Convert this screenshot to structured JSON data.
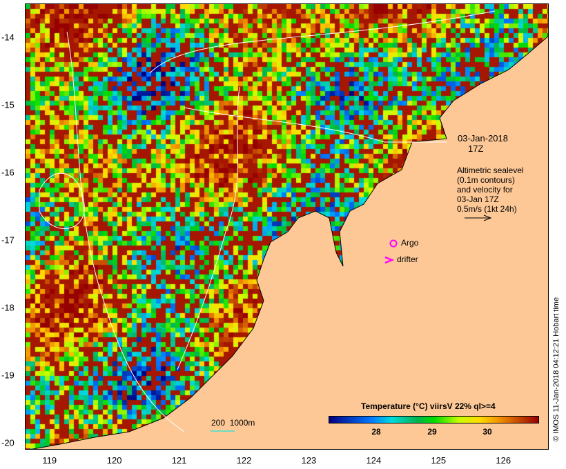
{
  "axes": {
    "x_ticks": [
      "119",
      "120",
      "121",
      "122",
      "123",
      "124",
      "125",
      "126"
    ],
    "x_values": [
      119,
      120,
      121,
      122,
      123,
      124,
      125,
      126
    ],
    "y_ticks": [
      "-14",
      "-15",
      "-16",
      "-17",
      "-18",
      "-19",
      "-20"
    ],
    "y_values": [
      -14,
      -15,
      -16,
      -17,
      -18,
      -19,
      -20
    ],
    "lon_range": [
      118.62,
      126.7
    ],
    "lat_range": [
      -13.5,
      -20.1
    ]
  },
  "annotation": {
    "date": "03-Jan-2018",
    "time": "17Z",
    "desc": [
      "Altimetric sealevel",
      "(0.1m contours)",
      "and velocity for",
      "03-Jan 17Z",
      "0.5m/s (1kt 24h)"
    ]
  },
  "legend": {
    "argo": "Argo",
    "drifter": "drifter",
    "bathy": "200  1000m"
  },
  "colorbar": {
    "title": "Temperature (°C) viirsV 22% ql>=4",
    "ticks": [
      "28",
      "29",
      "30"
    ],
    "tick_values": [
      28,
      29,
      30
    ],
    "range": [
      27.15,
      30.9
    ]
  },
  "credit": "© IMOS 11-Jan-2018 04:12:21 Hobart time",
  "colors": {
    "land": "#fdc896",
    "argo": "#ff00ff",
    "bathy": "#40e0d0"
  }
}
